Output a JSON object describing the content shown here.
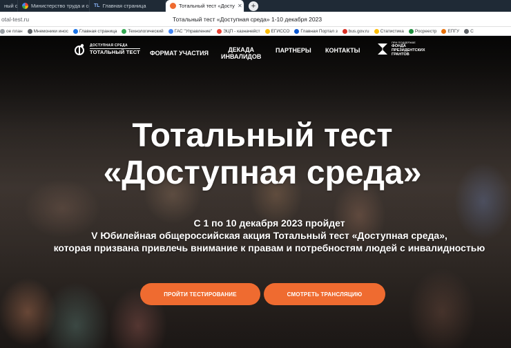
{
  "browser": {
    "tabs": [
      {
        "label": "ный с",
        "active": false,
        "color": "#8ab4f8"
      },
      {
        "label": "Министерство труда и со",
        "active": false,
        "color": "#fbbc04"
      },
      {
        "label": "Главная страница",
        "active": false,
        "color": "#4285f4",
        "prefix": "TL"
      },
      {
        "label": "Тотальный тест «Досту",
        "active": true,
        "color": "#ef6b30"
      }
    ],
    "url": "otal-test.ru",
    "page_title": "Тотальный тест «Доступная среда» 1-10 декабря 2023",
    "bookmarks": [
      {
        "label": "ое план",
        "color": "#9aa0a6"
      },
      {
        "label": "Мнемоники инос",
        "color": "#5f6368"
      },
      {
        "label": "Главная страница",
        "color": "#1a73e8"
      },
      {
        "label": "Технологический",
        "color": "#34a853"
      },
      {
        "label": "ГАС \"Управление\"",
        "color": "#4285f4"
      },
      {
        "label": "ЭЦП - казначейст",
        "color": "#ea4335"
      },
      {
        "label": "ЕГИССО",
        "color": "#fbbc04"
      },
      {
        "label": "Главная Портал з",
        "color": "#0b57d0"
      },
      {
        "label": "bus.gov.ru",
        "color": "#d93025"
      },
      {
        "label": "Статистика",
        "color": "#fbbc04"
      },
      {
        "label": "Росреестр",
        "color": "#1e8e3e"
      },
      {
        "label": "ЕПГУ",
        "color": "#e8710a"
      },
      {
        "label": "С",
        "color": "#5f6368"
      }
    ]
  },
  "nav": {
    "logo_small": "ДОСТУПНАЯ СРЕДА",
    "logo_big": "ТОТАЛЬНЫЙ ТЕСТ",
    "links": [
      "ФОРМАТ УЧАСТИЯ",
      "ДЕКАДА\nИНВАЛИДОВ",
      "ПАРТНЕРЫ",
      "КОНТАКТЫ"
    ],
    "grant_tiny": "ПРИ ПОДДЕРЖКЕ",
    "grant_1": "ФОНДА",
    "grant_2": "ПРЕЗИДЕНТСКИХ",
    "grant_3": "ГРАНТОВ"
  },
  "hero": {
    "title_line1": "Тотальный тест",
    "title_line2": "«Доступная среда»",
    "sub_line1": "С 1 по 10 декабря 2023 пройдет",
    "sub_line2": "V Юбилейная общероссийская акция Тотальный тест «Доступная среда»,",
    "sub_line3": "которая призвана привлечь внимание к правам и потребностям людей с инвалидностью",
    "button_test": "ПРОЙТИ ТЕСТИРОВАНИЕ",
    "button_stream": "СМОТРЕТЬ ТРАНСЛЯЦИЮ"
  },
  "colors": {
    "accent": "#ef6b30"
  }
}
